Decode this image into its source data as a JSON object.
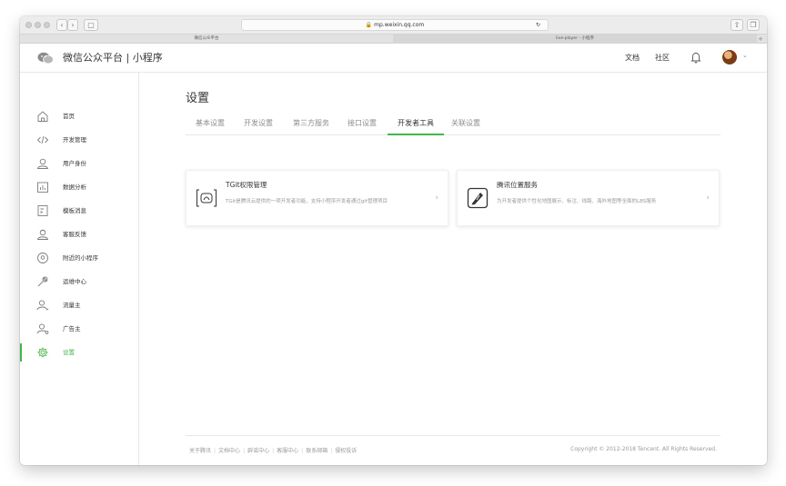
{
  "browser": {
    "url": "mp.weixin.qq.com",
    "tabs": [
      "微信公众平台",
      "live-player - 小程序"
    ]
  },
  "header": {
    "brand": "微信公众平台 | 小程序",
    "links": [
      "文档",
      "社区"
    ]
  },
  "sidebar": {
    "items": [
      {
        "label": "首页",
        "icon": "home-icon"
      },
      {
        "label": "开发管理",
        "icon": "code-icon"
      },
      {
        "label": "用户身份",
        "icon": "user-icon"
      },
      {
        "label": "数据分析",
        "icon": "chart-icon"
      },
      {
        "label": "模板消息",
        "icon": "template-icon"
      },
      {
        "label": "客服反馈",
        "icon": "service-icon"
      },
      {
        "label": "附近的小程序",
        "icon": "location-icon"
      },
      {
        "label": "运维中心",
        "icon": "wrench-icon"
      },
      {
        "label": "流量主",
        "icon": "traffic-user-icon"
      },
      {
        "label": "广告主",
        "icon": "advertiser-icon"
      },
      {
        "label": "设置",
        "icon": "gear-icon",
        "active": true
      }
    ]
  },
  "main": {
    "title": "设置",
    "tabs": [
      "基本设置",
      "开发设置",
      "第三方服务",
      "接口设置",
      "开发者工具",
      "关联设置"
    ],
    "active_tab": "开发者工具",
    "cards": [
      {
        "title": "TGit权限管理",
        "desc": "TGit是腾讯云提供的一项开发者功能，支持小程序开发者通过git管理项目",
        "icon": "git-bracket-icon"
      },
      {
        "title": "腾讯位置服务",
        "desc": "为开发者提供个性化地图展示、标注、线路、海外地图等全面的LBS服务",
        "icon": "map-pen-icon"
      }
    ]
  },
  "footer": {
    "links": [
      "关于腾讯",
      "文档中心",
      "辟谣中心",
      "客服中心",
      "联系邮箱",
      "侵权投诉"
    ],
    "copyright": "Copyright © 2012-2018 Tencent. All Rights Reserved."
  },
  "colors": {
    "accent": "#44b549",
    "text": "#353535",
    "muted": "#9a9a9a",
    "border": "#e7e7eb"
  }
}
